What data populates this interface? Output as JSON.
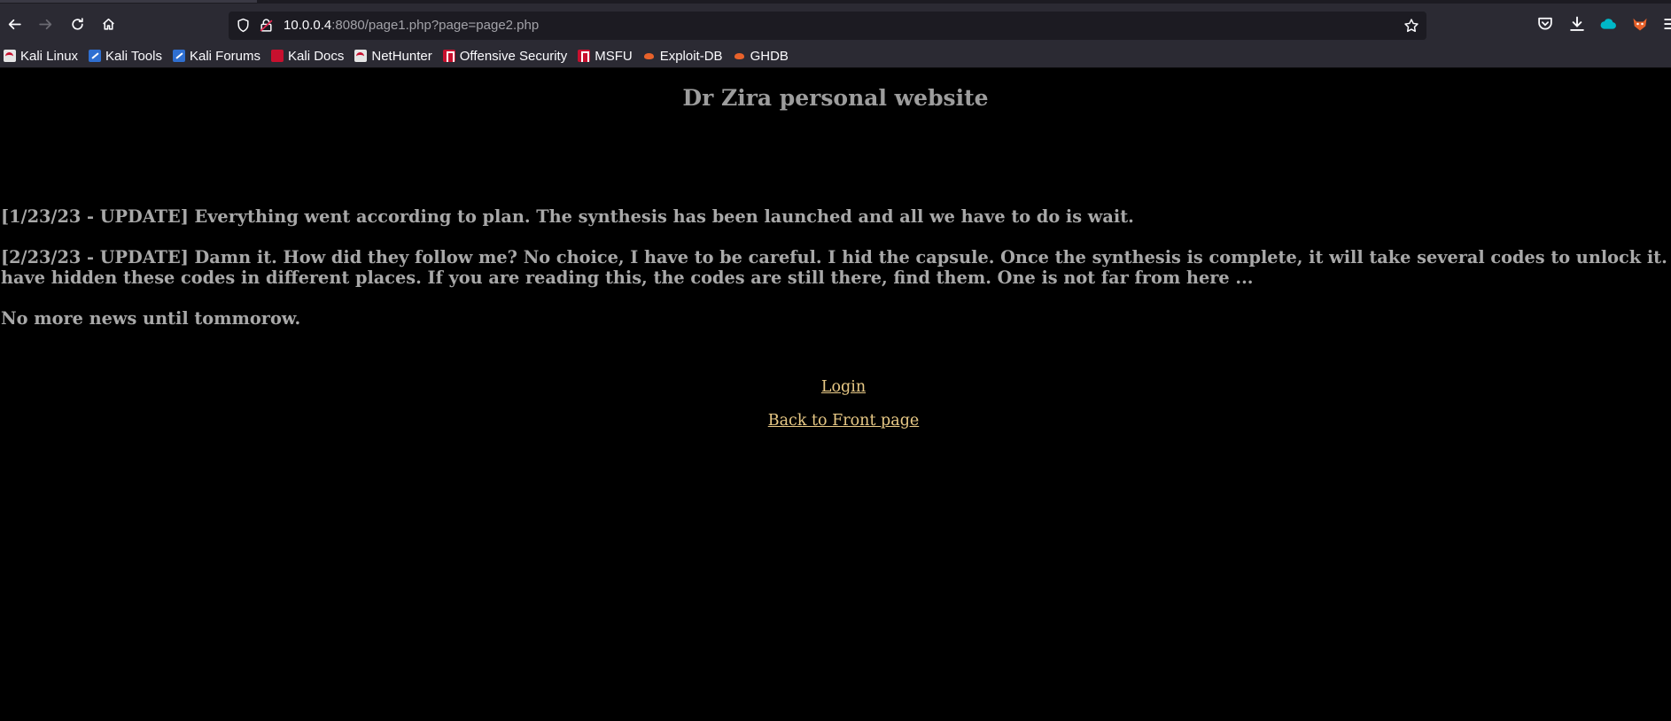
{
  "browser": {
    "url_host": "10.0.0.4",
    "url_rest": ":8080/page1.php?page=page2.php",
    "bookmarks": [
      {
        "label": "Kali Linux",
        "icon": "kali"
      },
      {
        "label": "Kali Tools",
        "icon": "tools"
      },
      {
        "label": "Kali Forums",
        "icon": "tools"
      },
      {
        "label": "Kali Docs",
        "icon": "docs"
      },
      {
        "label": "NetHunter",
        "icon": "kali"
      },
      {
        "label": "Offensive Security",
        "icon": "red"
      },
      {
        "label": "MSFU",
        "icon": "red"
      },
      {
        "label": "Exploit-DB",
        "icon": "orange"
      },
      {
        "label": "GHDB",
        "icon": "orange"
      }
    ]
  },
  "page": {
    "title": "Dr Zira personal website",
    "news": [
      "[1/23/23 - UPDATE] Everything went according to plan. The synthesis has been launched and all we have to do is wait.",
      "[2/23/23 - UPDATE] Damn it. How did they follow me? No choice, I have to be careful. I hid the capsule. Once the synthesis is complete, it will take several codes to unlock it. I have hidden these codes in different places. If you are reading this, the codes are still there, find them. One is not far from here ...",
      "No more news until tommorow."
    ],
    "links": {
      "login": "Login",
      "back": "Back to Front page"
    }
  },
  "colors": {
    "page_bg": "#000000",
    "text": "#a8a8a8",
    "link": "#e8c986",
    "chrome_bg": "#2b2a33",
    "urlbar_bg": "#1c1b22"
  }
}
